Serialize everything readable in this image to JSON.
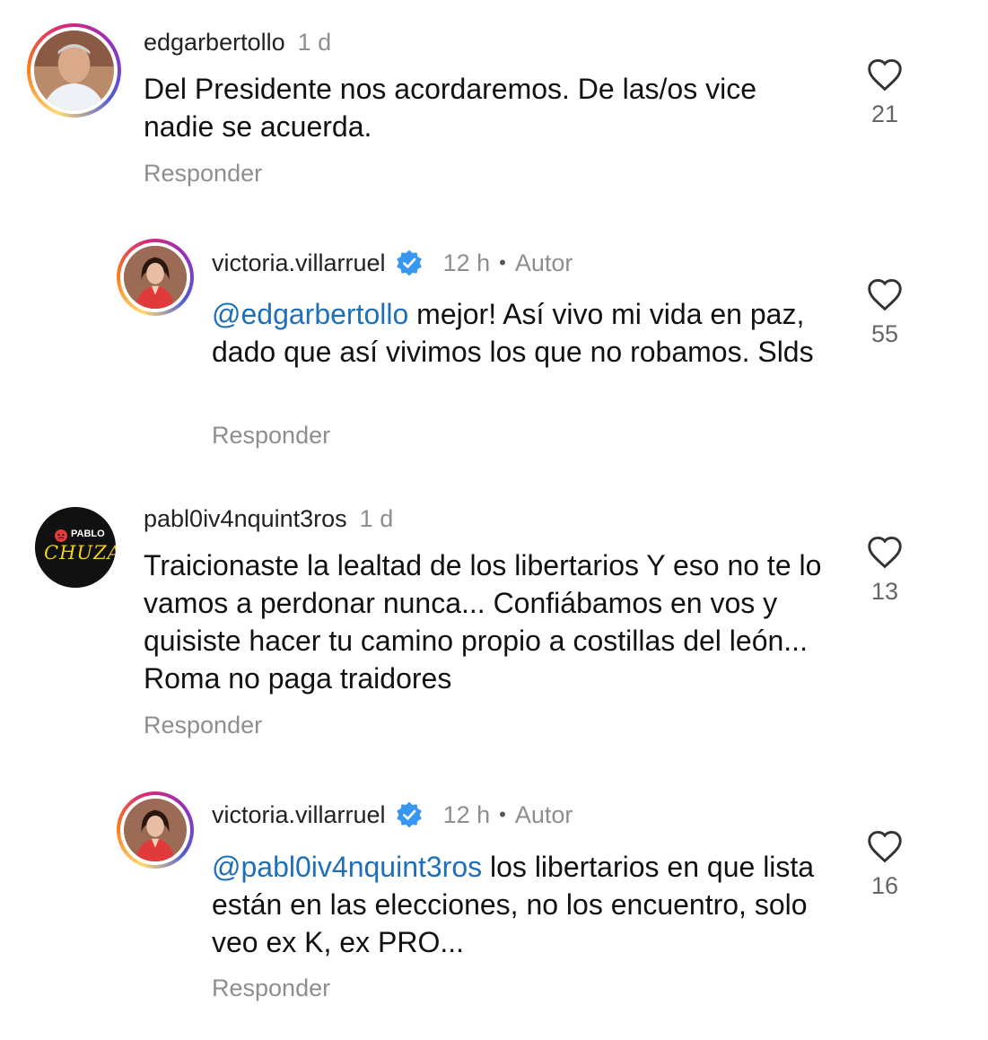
{
  "comments": [
    {
      "username": "edgarbertollo",
      "time": "1 d",
      "text": "Del Presidente nos acordaremos.  De las/os vice nadie se acuerda.",
      "reply_label": "Responder",
      "likes": "21",
      "icon": "heart-outline-icon"
    },
    {
      "username": "victoria.villarruel",
      "verified": true,
      "time": "12 h",
      "separator": "•",
      "badge": "Autor",
      "mention": "@edgarbertollo",
      "text": " mejor! Así vivo mi vida en paz, dado que así vivimos los que no robamos. Slds",
      "reply_label": "Responder",
      "likes": "55",
      "icon": "heart-outline-icon"
    },
    {
      "username": "pabl0iv4nquint3ros",
      "time": "1 d",
      "avatar_text_top": "PABLO",
      "avatar_text_bottom": "CHUZA",
      "text": "Traicionaste la lealtad de los libertarios Y eso no te lo vamos a perdonar nunca... Confiábamos en vos y quisiste hacer tu camino propio a costillas del león... Roma no paga traidores",
      "reply_label": "Responder",
      "likes": "13",
      "icon": "heart-outline-icon"
    },
    {
      "username": "victoria.villarruel",
      "verified": true,
      "time": "12 h",
      "separator": "•",
      "badge": "Autor",
      "mention": "@pabl0iv4nquint3ros",
      "text": " los libertarios en que lista están en las elecciones, no los encuentro, solo veo ex K, ex PRO...",
      "reply_label": "Responder",
      "likes": "16",
      "icon": "heart-outline-icon"
    }
  ],
  "colors": {
    "mention": "#1f6fb8",
    "verified": "#3897f0",
    "muted": "#8e8e8e"
  }
}
